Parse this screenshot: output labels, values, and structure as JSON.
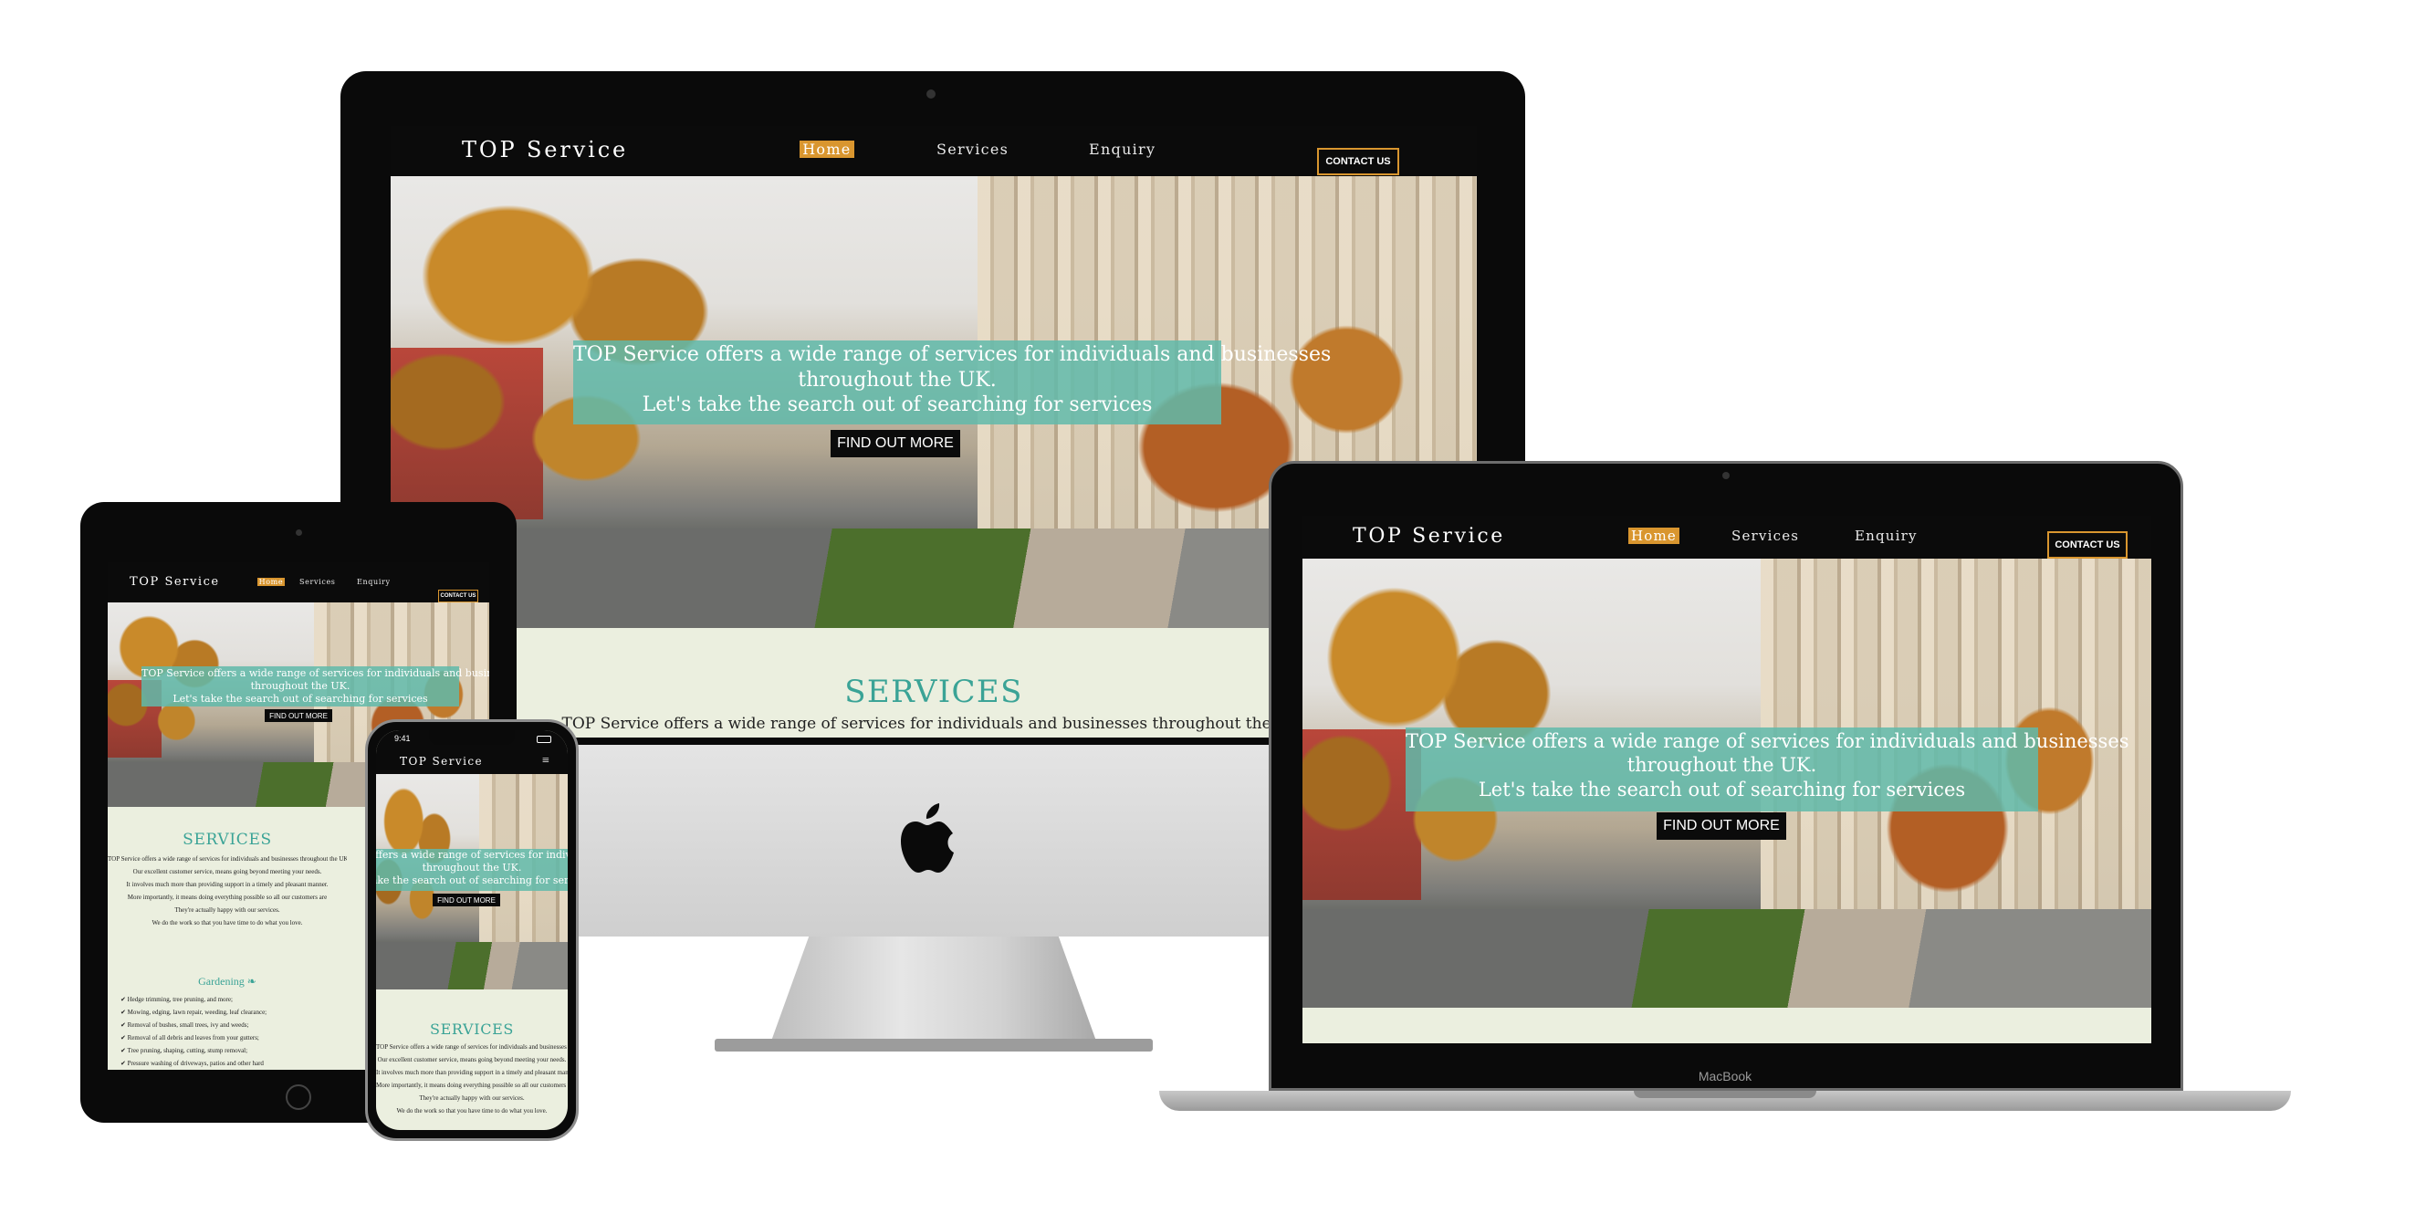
{
  "site": {
    "brand": "TOP Service",
    "nav": {
      "home": "Home",
      "services": "Services",
      "enquiry": "Enquiry"
    },
    "contact_button": "CONTACT US",
    "hero": {
      "line1": "TOP Service offers a wide range of services for individuals and businesses",
      "line2": "throughout the UK.",
      "line3": "Let's take the search out of searching for services",
      "cta": "FIND OUT MORE"
    },
    "services": {
      "title": "SERVICES",
      "intro": "TOP Service offers a wide range of services for individuals and businesses throughout the UK.",
      "lines": [
        "TOP Service offers a wide range of services for individuals and businesses throughout the UK.",
        "Our excellent customer service, means going beyond meeting your needs.",
        "It involves much more than providing support in a timely and pleasant manner.",
        "More importantly, it means doing everything possible so all our customers are",
        "They're actually happy with our services.",
        "We do the work so that you have time to do what you love."
      ],
      "gardening_title": "Gardening",
      "gardening_items": [
        "Hedge trimming, tree pruning, and more;",
        "Mowing, edging, lawn repair, weeding, leaf clearance;",
        "Removal of bushes, small trees, ivy and weeds;",
        "Removal of all debris and leaves from your gutters;",
        "Tree pruning, shaping, cutting, stump removal;",
        "Pressure washing of driveways, patios and other hard"
      ]
    }
  },
  "phone": {
    "time": "9:41",
    "menu_icon": "hamburger-icon"
  },
  "laptop_label": "MacBook",
  "colors": {
    "nav_bg": "#0b0b0b",
    "accent": "#d9962f",
    "teal": "#3aa396",
    "banner": "#60baaa",
    "section_bg": "#ebefdf"
  }
}
